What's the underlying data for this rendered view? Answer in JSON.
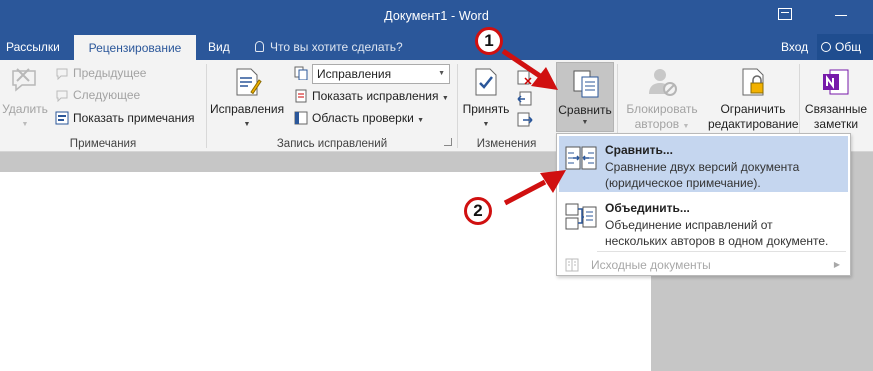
{
  "window": {
    "title": "Документ1 - Word"
  },
  "tabs": {
    "mailings": "Рассылки",
    "review": "Рецензирование",
    "view": "Вид",
    "tell_me": "Что вы хотите сделать?",
    "login": "Вход",
    "share": "Общ"
  },
  "ribbon": {
    "comments": {
      "delete": "Удалить",
      "previous": "Предыдущее",
      "next": "Следующее",
      "show_comments": "Показать примечания",
      "label": "Примечания"
    },
    "tracking": {
      "track_changes": "Исправления",
      "display_value": "Исправления",
      "show_markup": "Показать исправления",
      "reviewing_pane": "Область проверки",
      "label": "Запись исправлений"
    },
    "changes": {
      "accept": "Принять",
      "label": "Изменения"
    },
    "compare": {
      "compare": "Сравнить"
    },
    "protect": {
      "block_authors_1": "Блокировать",
      "block_authors_2": "авторов",
      "restrict_editing_1": "Ограничить",
      "restrict_editing_2": "редактирование"
    },
    "onenote": {
      "linked_notes_1": "Связанные",
      "linked_notes_2": "заметки"
    }
  },
  "menu": {
    "compare_title": "Сравнить...",
    "compare_desc_1": "Сравнение двух версий документа",
    "compare_desc_2": "(юридическое примечание).",
    "combine_title": "Объединить...",
    "combine_desc_1": "Объединение исправлений от",
    "combine_desc_2": "нескольких авторов в одном документе.",
    "source_documents": "Исходные документы"
  },
  "annotations": {
    "step1": "1",
    "step2": "2"
  },
  "colors": {
    "word_blue": "#2b579a",
    "highlight": "#c5d6ef",
    "annotation_red": "#d01010"
  }
}
